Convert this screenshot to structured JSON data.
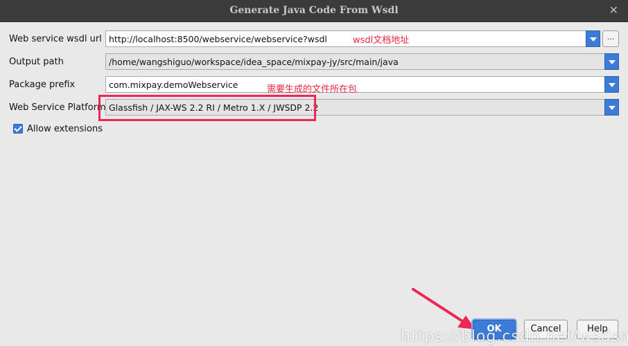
{
  "dialog": {
    "title": "Generate Java Code From Wsdl"
  },
  "form": {
    "wsdl_url": {
      "label": "Web service wsdl url",
      "value": "http://localhost:8500/webservice/webservice?wsdl",
      "browse_label": "..."
    },
    "output_path": {
      "label": "Output path",
      "value": "/home/wangshiguo/workspace/idea_space/mixpay-jy/src/main/java"
    },
    "package_prefix": {
      "label": "Package prefix",
      "value": "com.mixpay.demoWebservice"
    },
    "platform": {
      "label": "Web Service Platform",
      "value": "Glassfish / JAX-WS 2.2 RI / Metro 1.X / JWSDP 2.2"
    },
    "allow_extensions": {
      "label": "Allow extensions",
      "checked": true
    }
  },
  "annotations": {
    "wsdl_note": "wsdl文档地址",
    "package_note": "需要生成的文件所在包"
  },
  "buttons": {
    "ok": "OK",
    "cancel": "Cancel",
    "help": "Help"
  },
  "watermark": "https://blog.csdn.net/wsdsm",
  "colors": {
    "accent": "#3c7cd6",
    "annotation": "#e8263f"
  }
}
